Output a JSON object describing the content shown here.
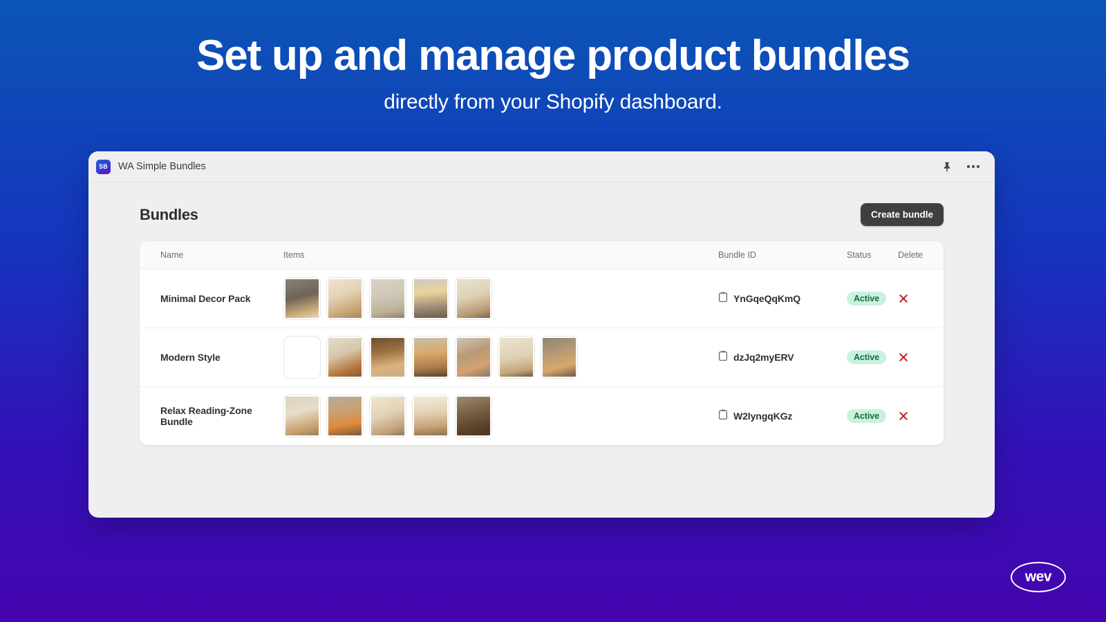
{
  "hero": {
    "title": "Set up and manage product bundles",
    "subtitle": "directly from your Shopify dashboard."
  },
  "window": {
    "logo_text": "SB",
    "app_title": "WA Simple Bundles",
    "pin_icon": "pin-icon",
    "more_icon": "more-options-icon"
  },
  "page": {
    "title": "Bundles",
    "create_button": "Create bundle"
  },
  "table": {
    "headers": {
      "name": "Name",
      "items": "Items",
      "bundle_id": "Bundle ID",
      "status": "Status",
      "delete": "Delete"
    },
    "rows": [
      {
        "name": "Minimal Decor Pack",
        "bundle_id": "YnGqeQqKmQ",
        "status": "Active",
        "item_count": 5,
        "thumbs": [
          "linear-gradient(165deg,#8a8074 0%,#6f6459 45%,#c9a878 78%,#e8d8b8 100%)",
          "linear-gradient(160deg,#efe4cf 0%,#e3d3b4 40%,#c8a878 75%,#a8855c 100%)",
          "linear-gradient(170deg,#d8d2c6 0%,#cfc7b6 45%,#bdae95 80%,#8e8070 100%)",
          "linear-gradient(175deg,#cfcac0 0%,#e8d39c 35%,#9d8a74 72%,#6b5a46 100%)",
          "linear-gradient(165deg,#e9e1cf 0%,#ddd0b6 45%,#b89a72 80%,#7d6448 100%)"
        ]
      },
      {
        "name": "Modern Style",
        "bundle_id": "dzJq2myERV",
        "status": "Active",
        "item_count": 7,
        "thumbs": [
          "linear-gradient(165deg,#ddd0b9 0%,#cdbb9e 45%,#9e8straight 0%,#8a7259 100%)",
          "linear-gradient(160deg,#e5dbc7 0%,#d6c6a9 42%,#b5743c 78%,#8d5a2e 100%)",
          "linear-gradient(170deg,#6d4d2e 0%,#9b7040 35%,#d8b27a 70%,#c9ae86 100%)",
          "linear-gradient(175deg,#cbbfa8 0%,#d8a86a 40%,#a87b4c 75%,#5c452e 100%)",
          "linear-gradient(160deg,#cfc6b6 0%,#b79a78 40%,#d4a172 72%,#8a7a66 100%)",
          "linear-gradient(170deg,#ece3cf 0%,#ddd0b4 50%,#c3a478 82%,#6f5c44 100%)",
          "linear-gradient(165deg,#8e8474 0%,#b89a74 40%,#d8a86c 72%,#6b5a46 100%)"
        ]
      },
      {
        "name": "Relax Reading-Zone Bundle",
        "bundle_id": "W2lyngqKGz",
        "status": "Active",
        "item_count": 5,
        "thumbs": [
          "linear-gradient(165deg,#ddd2bd 0%,#e6ddcb 40%,#c9a06a 78%,#9a8060 100%)",
          "linear-gradient(170deg,#b8ab98 0%,#c9a070 40%,#e08a3c 70%,#7a5a3a 100%)",
          "linear-gradient(160deg,#efe6d2 0%,#e0d2b6 45%,#c2a179 80%,#8e7a5c 100%)",
          "linear-gradient(175deg,#f2ead8 0%,#e2d4b8 40%,#caa276 75%,#8d7050 100%)",
          "linear-gradient(165deg,#9e8a70 0%,#7a6045 40%,#5a422c 75%,#4a3624 100%)"
        ]
      }
    ]
  },
  "brand": {
    "logo_text": "wev"
  }
}
